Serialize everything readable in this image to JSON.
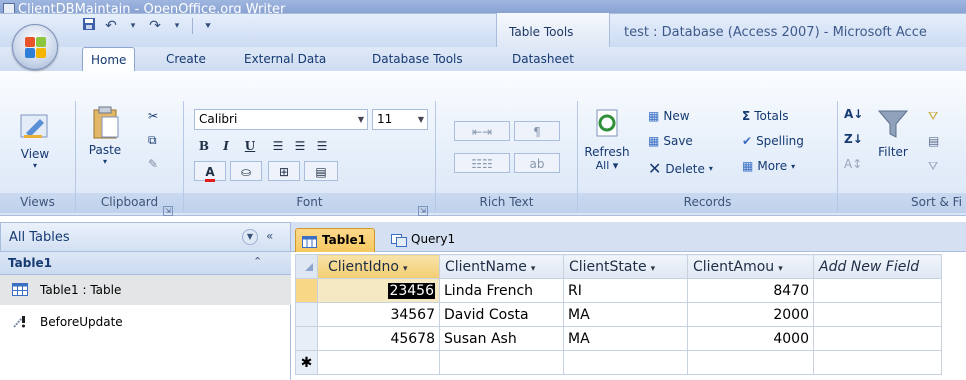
{
  "bg_window": {
    "title": "ClientDBMaintain - OpenOffice.org Writer"
  },
  "qat": {
    "save_icon": "save-icon",
    "undo_icon": "undo-icon",
    "redo_icon": "redo-icon"
  },
  "contextual": {
    "table_tools": "Table Tools"
  },
  "window_title": "test : Database (Access 2007) - Microsoft Acce",
  "tabs": [
    "Home",
    "Create",
    "External Data",
    "Database Tools",
    "Datasheet"
  ],
  "ribbon": {
    "views": {
      "view_label": "View",
      "group": "Views"
    },
    "clipboard": {
      "paste_label": "Paste",
      "group": "Clipboard"
    },
    "font": {
      "family": "Calibri",
      "size": "11",
      "bold": "B",
      "italic": "I",
      "underline": "U",
      "font_color": "A",
      "group": "Font"
    },
    "rich_text": {
      "group": "Rich Text"
    },
    "records": {
      "refresh_label": "Refresh",
      "refresh_sub": "All",
      "new": "New",
      "save": "Save",
      "delete": "Delete",
      "totals": "Totals",
      "spelling": "Spelling",
      "more": "More",
      "group": "Records"
    },
    "sort": {
      "filter_label": "Filter",
      "group": "Sort & Fi"
    }
  },
  "nav": {
    "header": "All Tables",
    "group": "Table1",
    "items": [
      {
        "label": "Table1 : Table"
      },
      {
        "label": "BeforeUpdate"
      }
    ]
  },
  "doc_tabs": [
    "Table1",
    "Query1"
  ],
  "grid": {
    "columns": [
      "ClientIdno",
      "ClientName",
      "ClientState",
      "ClientAmou",
      "Add New Field"
    ],
    "rows": [
      {
        "id": "23456",
        "name": "Linda French",
        "state": "RI",
        "amount": "8470"
      },
      {
        "id": "34567",
        "name": "David Costa",
        "state": "MA",
        "amount": "2000"
      },
      {
        "id": "45678",
        "name": "Susan Ash",
        "state": "MA",
        "amount": "4000"
      }
    ],
    "new_row_marker": "✱"
  }
}
